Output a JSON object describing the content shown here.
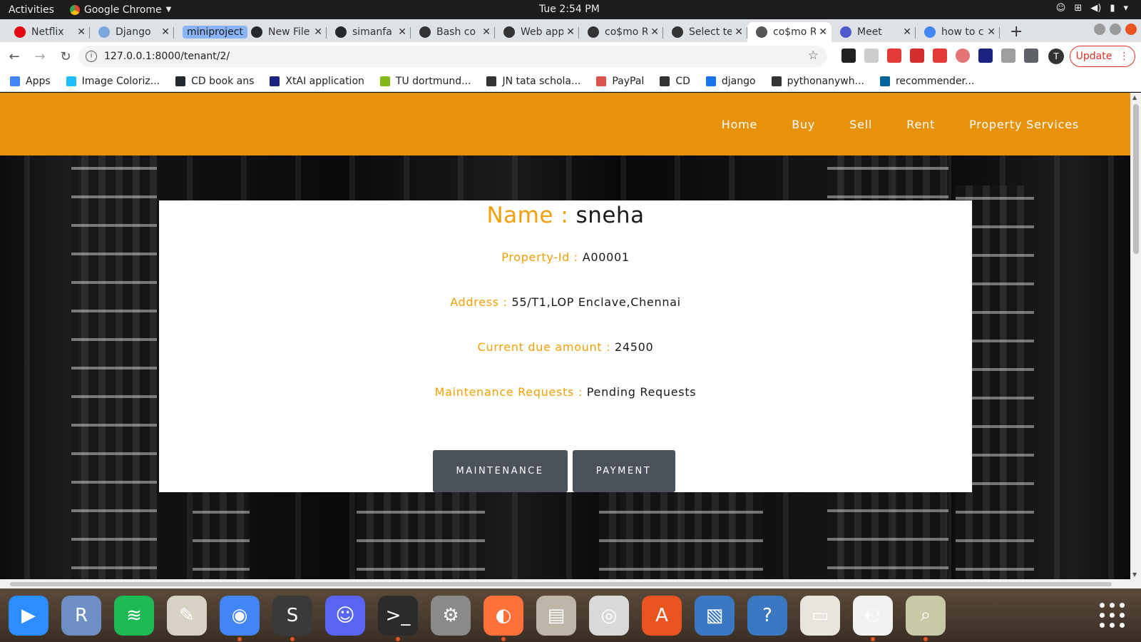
{
  "os": {
    "activities": "Activities",
    "app_name": "Google Chrome",
    "clock": "Tue  2:54 PM"
  },
  "tabs": [
    {
      "title": "Netflix",
      "icon_color": "#e50914"
    },
    {
      "title": "Django",
      "icon_color": "#7aa7d9"
    },
    {
      "title": "miniproject",
      "group": true
    },
    {
      "title": "New File",
      "icon_color": "#24292e"
    },
    {
      "title": "simanfa",
      "icon_color": "#24292e"
    },
    {
      "title": "Bash co",
      "icon_color": "#333333"
    },
    {
      "title": "Web app",
      "icon_color": "#333333"
    },
    {
      "title": "co$mo R",
      "icon_color": "#333333"
    },
    {
      "title": "Select te",
      "icon_color": "#333333"
    },
    {
      "title": "co$mo R",
      "icon_color": "#555555",
      "active": true
    },
    {
      "title": "Meet",
      "icon_color": "#5059c9"
    },
    {
      "title": "how to c",
      "icon_color": "#4285f4"
    }
  ],
  "toolbar": {
    "url": "127.0.0.1:8000/tenant/2/",
    "update_label": "Update",
    "avatar_initial": "T"
  },
  "bookmarks": [
    {
      "label": "Apps",
      "icon": "apps-grid-icon",
      "color": "#4285f4"
    },
    {
      "label": "Image Coloriz...",
      "icon": "kaggle-icon",
      "color": "#20beff"
    },
    {
      "label": "CD book ans",
      "icon": "github-icon",
      "color": "#24292e"
    },
    {
      "label": "XtAI application",
      "icon": "xtai-icon",
      "color": "#1a237e"
    },
    {
      "label": "TU dortmund...",
      "icon": "tu-icon",
      "color": "#84b819"
    },
    {
      "label": "JN tata schola...",
      "icon": "globe-icon",
      "color": "#333333"
    },
    {
      "label": "PayPal",
      "icon": "paypal-icon",
      "color": "#d9534f"
    },
    {
      "label": "CD",
      "icon": "globe-icon",
      "color": "#333333"
    },
    {
      "label": "django",
      "icon": "book-icon",
      "color": "#1a73e8"
    },
    {
      "label": "pythonanywh...",
      "icon": "pythonanywhere-icon",
      "color": "#333333"
    },
    {
      "label": "recommender...",
      "icon": "ieee-icon",
      "color": "#00629b"
    }
  ],
  "site_nav": [
    "Home",
    "Buy",
    "Sell",
    "Rent",
    "Property Services"
  ],
  "tenant": {
    "name_label": "Name : ",
    "name": "sneha",
    "property_id_label": "Property-Id : ",
    "property_id": "A00001",
    "address_label": "Address : ",
    "address": "55/T1,LOP Enclave,Chennai",
    "due_label": "Current due amount : ",
    "due": "24500",
    "maintenance_label": "Maintenance Requests : ",
    "maintenance": "Pending Requests"
  },
  "buttons": {
    "maintenance": "MAINTENANCE",
    "payment": "PAYMENT"
  },
  "colors": {
    "brand_orange": "#e8920a",
    "label_orange": "#f29f05",
    "button_gray": "#4b525c"
  },
  "dock": [
    {
      "name": "zoom-icon",
      "color": "#2d8cff",
      "glyph": "▶",
      "running": false
    },
    {
      "name": "r-icon",
      "color": "#6d8fc4",
      "glyph": "R",
      "running": false
    },
    {
      "name": "spotify-icon",
      "color": "#1db954",
      "glyph": "≋",
      "running": false
    },
    {
      "name": "text-editor-icon",
      "color": "#d8d2c4",
      "glyph": "✎",
      "running": false
    },
    {
      "name": "chrome-icon",
      "color": "#4285f4",
      "glyph": "◉",
      "running": true
    },
    {
      "name": "sublime-icon",
      "color": "#3a3a3a",
      "glyph": "S",
      "running": true
    },
    {
      "name": "discord-icon",
      "color": "#5865f2",
      "glyph": "☺",
      "running": false
    },
    {
      "name": "terminal-icon",
      "color": "#2b2b2b",
      "glyph": ">_",
      "running": true
    },
    {
      "name": "settings-icon",
      "color": "#8a8a8a",
      "glyph": "⚙",
      "running": false
    },
    {
      "name": "firefox-icon",
      "color": "#ff7139",
      "glyph": "◐",
      "running": true
    },
    {
      "name": "files-icon",
      "color": "#bdb6a8",
      "glyph": "▤",
      "running": false
    },
    {
      "name": "speaker-icon",
      "color": "#d9d9d9",
      "glyph": "◎",
      "running": false
    },
    {
      "name": "software-center-icon",
      "color": "#e95420",
      "glyph": "A",
      "running": false
    },
    {
      "name": "image-viewer-icon",
      "color": "#3a78c2",
      "glyph": "▧",
      "running": false
    },
    {
      "name": "help-icon",
      "color": "#3a78c2",
      "glyph": "?",
      "running": false
    },
    {
      "name": "presentation-icon",
      "color": "#e9e4dc",
      "glyph": "▭",
      "running": false
    },
    {
      "name": "pdf-reader-icon",
      "color": "#f2f2f2",
      "glyph": "℮",
      "running": true
    },
    {
      "name": "image-search-icon",
      "color": "#c9c9a8",
      "glyph": "⌕",
      "running": true
    }
  ]
}
